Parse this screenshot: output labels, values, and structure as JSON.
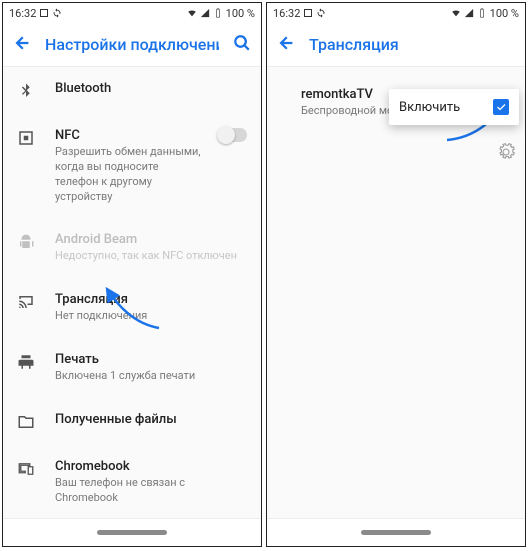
{
  "status": {
    "time": "16:32",
    "battery": "100 %"
  },
  "left": {
    "title": "Настройки подключения",
    "items": {
      "bluetooth": {
        "label": "Bluetooth"
      },
      "nfc": {
        "label": "NFC",
        "sub": "Разрешить обмен данными, когда вы подносите телефон к другому устройству"
      },
      "beam": {
        "label": "Android Beam",
        "sub": "Недоступно, так как NFC отключен"
      },
      "cast": {
        "label": "Трансляция",
        "sub": "Нет подключения"
      },
      "print": {
        "label": "Печать",
        "sub": "Включена 1 служба печати"
      },
      "files": {
        "label": "Полученные файлы"
      },
      "chromebook": {
        "label": "Chromebook",
        "sub": "Ваш телефон не связан с Chromebook"
      }
    }
  },
  "right": {
    "title": "Трансляция",
    "popup": {
      "label": "Включить",
      "checked": true
    },
    "device": {
      "name": "remontkaTV",
      "sub": "Беспроводной монитор"
    }
  },
  "colors": {
    "accent": "#1a73e8"
  }
}
